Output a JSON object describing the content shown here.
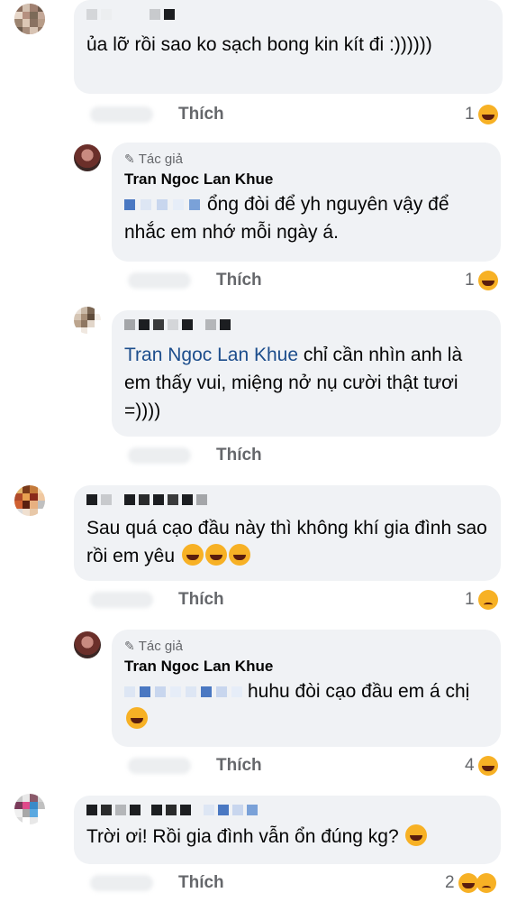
{
  "comments": [
    {
      "text": "ủa lỡ rồi sao ko sạch bong kin kít đi :))))))",
      "like_label": "Thích",
      "reaction_count": "1"
    },
    {
      "author_tag": "Tác giả",
      "author_name": "Tran Ngoc Lan Khue",
      "text": "ổng đòi để yh nguyên vậy để nhắc em nhớ mỗi ngày á.",
      "like_label": "Thích",
      "reaction_count": "1"
    },
    {
      "mention": "Tran Ngoc Lan Khue",
      "text": " chỉ cần nhìn anh là em thấy vui, miệng nở nụ cười thật tươi =))))",
      "like_label": "Thích"
    },
    {
      "text": "Sau quá cạo đầu này thì không khí gia đình sao rồi em yêu",
      "like_label": "Thích",
      "reaction_count": "1"
    },
    {
      "author_tag": "Tác giả",
      "author_name": "Tran Ngoc Lan Khue",
      "text": "huhu đòi cạo đầu em á chị",
      "like_label": "Thích",
      "reaction_count": "4"
    },
    {
      "text": "Trời ơi! Rồi gia đình vẫn ổn đúng kg?",
      "like_label": "Thích",
      "reaction_count": "2"
    }
  ],
  "icons": {
    "pencil": "pencil-icon",
    "haha": "haha-reaction-icon",
    "sad": "sad-reaction-icon",
    "sweat_smile": "sweat-smile-emoji",
    "rofl": "rofl-emoji",
    "teary": "teary-emoji"
  }
}
